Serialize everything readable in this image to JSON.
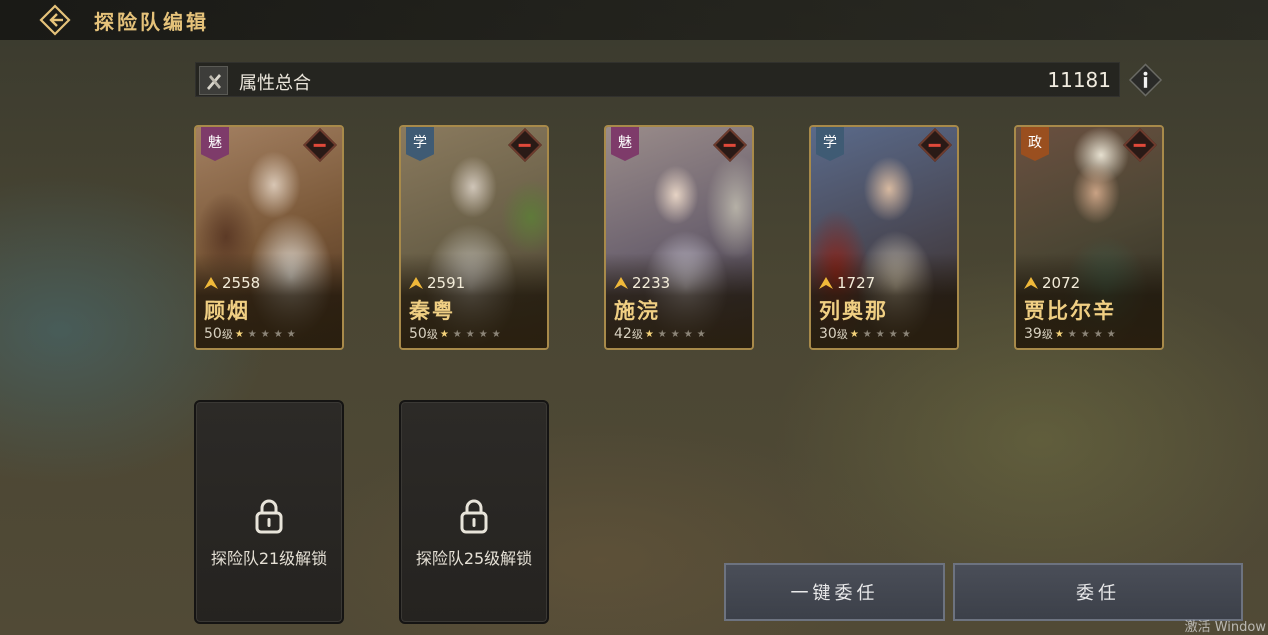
{
  "header": {
    "title": "探险队编辑"
  },
  "attributes": {
    "label": "属性总合",
    "total": "11181"
  },
  "heroes": [
    {
      "name": "顾烟",
      "badge": "魅",
      "power": "2558",
      "level": "50",
      "level_unit": "级",
      "stars": 1
    },
    {
      "name": "秦粤",
      "badge": "学",
      "power": "2591",
      "level": "50",
      "level_unit": "级",
      "stars": 1
    },
    {
      "name": "施浣",
      "badge": "魅",
      "power": "2233",
      "level": "42",
      "level_unit": "级",
      "stars": 1
    },
    {
      "name": "列奥那",
      "badge": "学",
      "power": "1727",
      "level": "30",
      "level_unit": "级",
      "stars": 1
    },
    {
      "name": "贾比尔辛",
      "badge": "政",
      "power": "2072",
      "level": "39",
      "level_unit": "级",
      "stars": 1
    }
  ],
  "locked_slots": [
    {
      "text": "探险队21级解锁"
    },
    {
      "text": "探险队25级解锁"
    }
  ],
  "actions": {
    "auto_assign": "一键委任",
    "assign": "委任"
  },
  "watermark": "激活 Window",
  "colors": {
    "accent_gold": "#e5c27a",
    "badge_charm": "#7e3b6a",
    "badge_study": "#3f5b74",
    "badge_politics": "#9a4f1f",
    "remove_red": "#e0493a"
  }
}
